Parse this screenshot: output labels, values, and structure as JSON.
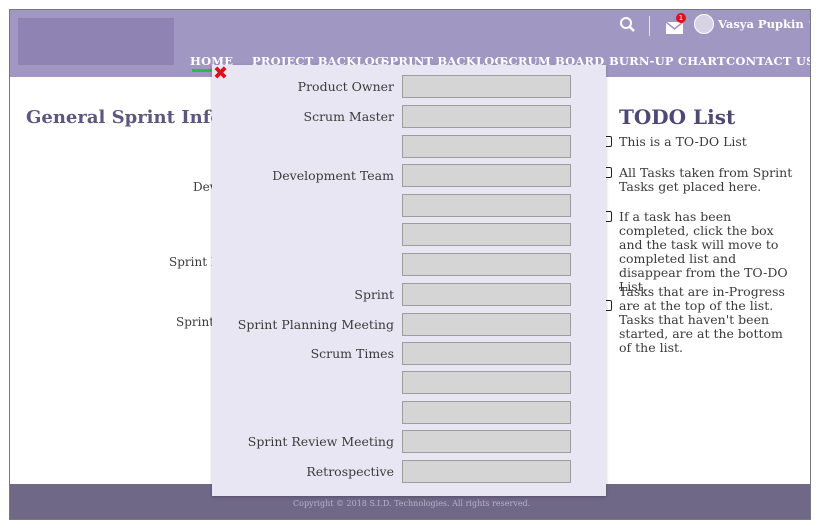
{
  "header": {
    "nav": [
      "HOME",
      "PROJECT BACKLOG",
      "SPRINT BACKLOG",
      "SCRUM BOARD",
      "BURN-UP CHART",
      "CONTACT US"
    ],
    "mail_badge": "1",
    "username": "Vasya Pupkin ∨"
  },
  "general": {
    "title": "General Sprint Informa",
    "labels": [
      "Dev",
      "Sprint P",
      "Sprint"
    ]
  },
  "todo": {
    "title": "TODO List",
    "items": [
      "This is a TO-DO List",
      "All Tasks taken from Sprint Tasks get placed here.",
      "If a task has been completed, click the box and the task will move to completed list and disappear from the TO-DO List.",
      "Tasks that are in-Progress are at the top of the list. Tasks that haven't been started, are at the bottom of the list."
    ]
  },
  "modal": {
    "labels": {
      "product_owner": "Product Owner",
      "scrum_master": "Scrum Master",
      "development_team": "Development Team",
      "sprint": "Sprint",
      "sprint_planning": "Sprint Planning Meeting",
      "scrum_times": "Scrum Times",
      "sprint_review": "Sprint Review Meeting",
      "retrospective": "Retrospective"
    }
  },
  "footer": {
    "copyright": "Copyright © 2018 S.I.D. Technologies. All rights reserved."
  },
  "colors": {
    "header": "#a197c3",
    "footer": "#6f6887",
    "modal": "#e9e6f3",
    "accent_underline": "#31b84a",
    "close": "#d6141a"
  },
  "icons": [
    "search-icon",
    "mail-icon",
    "avatar",
    "close-icon",
    "checkbox-icon"
  ]
}
